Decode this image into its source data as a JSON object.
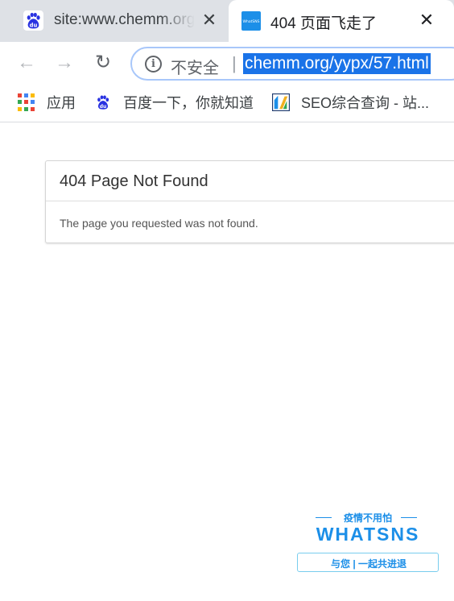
{
  "tabs": [
    {
      "title": "site:www.chemm.org",
      "favicon": "baidu-paw-icon",
      "active": false
    },
    {
      "title": "404 页面飞走了",
      "favicon": "whatsns-favicon",
      "favicon_text": "WhatSNS",
      "active": true
    }
  ],
  "toolbar": {
    "security_label": "不安全",
    "url": "chemm.org/yypx/57.html"
  },
  "bookmarks": [
    {
      "label": "应用",
      "icon": "apps-grid-icon"
    },
    {
      "label": "百度一下，你就知道",
      "icon": "baidu-paw-icon"
    },
    {
      "label": "SEO综合查询 - 站...",
      "icon": "seo-chart-icon"
    }
  ],
  "page": {
    "heading": "404 Page Not Found",
    "message": "The page you requested was not found."
  },
  "watermark": {
    "tagline": "疫情不用怕",
    "brand": "WHATSNS",
    "slogan": "与您 | 一起共进退"
  },
  "colors": {
    "tab_strip": "#dee1e6",
    "url_highlight": "#1a73e8",
    "omnibox_border": "#a8c7fa",
    "brand_blue": "#1c8fe8"
  }
}
